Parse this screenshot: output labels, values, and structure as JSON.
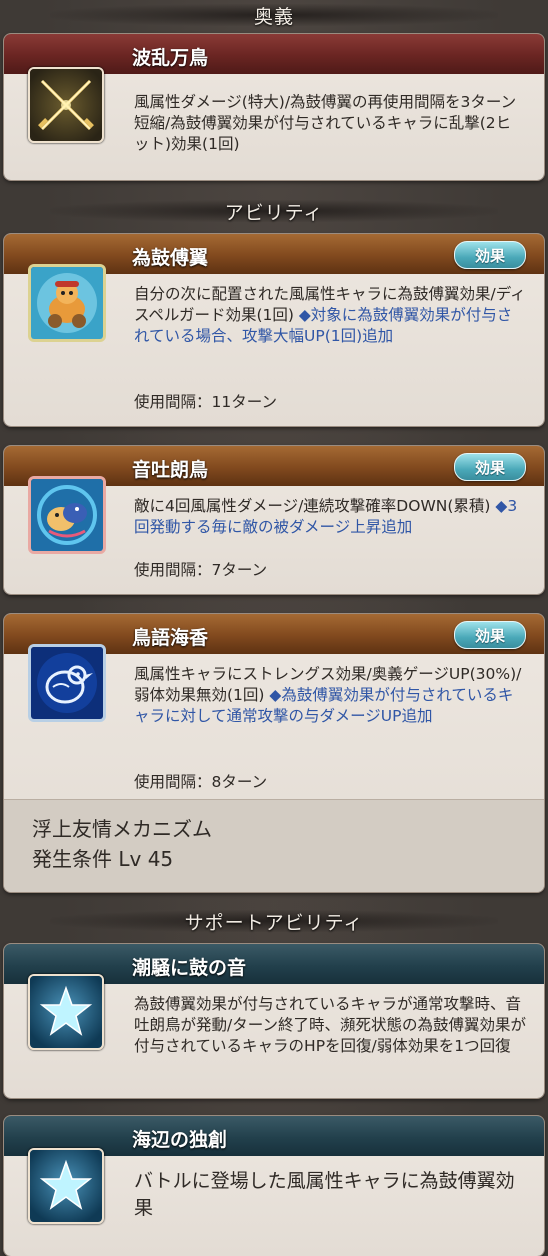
{
  "sections": {
    "ougi": "奥義",
    "abilities": "アビリティ",
    "support": "サポートアビリティ"
  },
  "ougi": {
    "name": "波乱万鳥",
    "description": "風属性ダメージ(特大)/為鼓傅翼の再使用間隔を3ターン短縮/為鼓傅翼効果が付与されているキャラに乱撃(2ヒット)効果(1回)"
  },
  "effect_button_label": "効果",
  "abilities": [
    {
      "name": "為鼓傅翼",
      "description": "自分の次に配置された風属性キャラに為鼓傅翼効果/ディスペルガード効果(1回)",
      "note": "◆対象に為鼓傅翼効果が付与されている場合、攻撃大幅UP(1回)追加",
      "cooldown": "使用間隔：11ターン"
    },
    {
      "name": "音吐朗鳥",
      "description": "敵に4回風属性ダメージ/連続攻撃確率DOWN(累積)",
      "note": "◆3回発動する毎に敵の被ダメージ上昇追加",
      "cooldown": "使用間隔：7ターン"
    },
    {
      "name": "鳥語海香",
      "description": "風属性キャラにストレングス効果/奥義ゲージUP(30%)/弱体効果無効(1回)",
      "note": "◆為鼓傅翼効果が付与されているキャラに対して通常攻撃の与ダメージUP追加",
      "cooldown": "使用間隔：8ターン",
      "mechanism": "浮上友情メカニズム",
      "condition": "発生条件 Lv 45"
    }
  ],
  "support": [
    {
      "name": "潮騒に鼓の音",
      "description": "為鼓傅翼効果が付与されているキャラが通常攻撃時、音吐朗鳥が発動/ターン終了時、瀕死状態の為鼓傅翼効果が付与されているキャラのHPを回復/弱体効果を1つ回復"
    },
    {
      "name": "海辺の独創",
      "description": "バトルに登場した風属性キャラに為鼓傅翼効果"
    }
  ],
  "icons": [
    "crossed-swords-icon",
    "bird-drum-icon",
    "bird-singing-icon",
    "blue-bird-icon",
    "star-icon",
    "star-icon"
  ]
}
